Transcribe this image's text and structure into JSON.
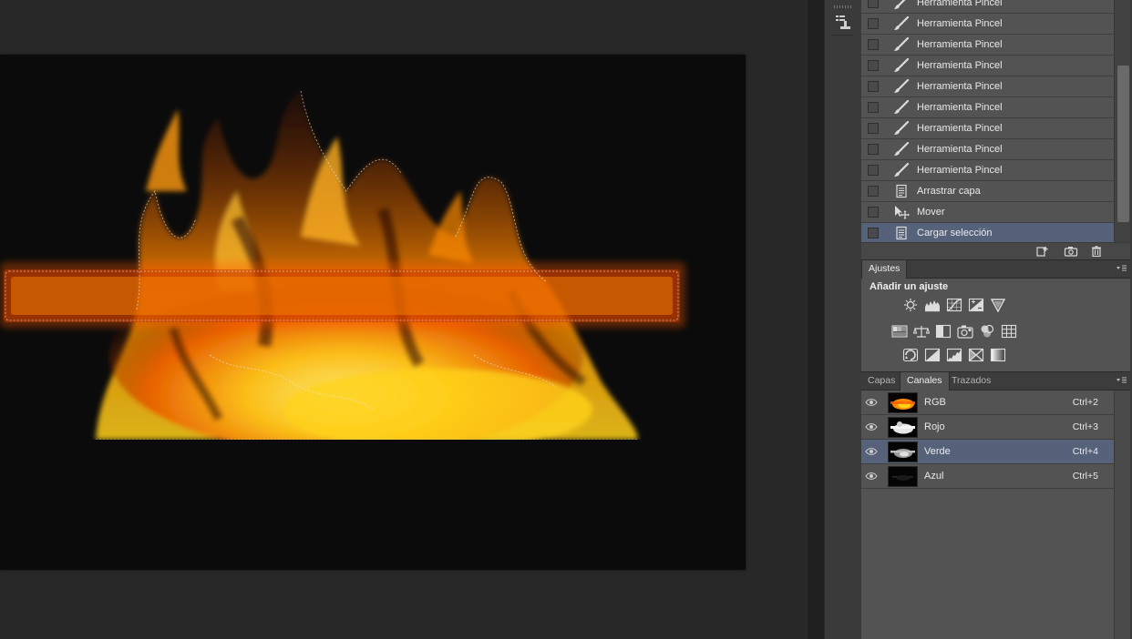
{
  "history": {
    "items": [
      {
        "label": "Herramienta Pincel",
        "icon": "brush-icon",
        "selected": false
      },
      {
        "label": "Herramienta Pincel",
        "icon": "brush-icon",
        "selected": false
      },
      {
        "label": "Herramienta Pincel",
        "icon": "brush-icon",
        "selected": false
      },
      {
        "label": "Herramienta Pincel",
        "icon": "brush-icon",
        "selected": false
      },
      {
        "label": "Herramienta Pincel",
        "icon": "brush-icon",
        "selected": false
      },
      {
        "label": "Herramienta Pincel",
        "icon": "brush-icon",
        "selected": false
      },
      {
        "label": "Herramienta Pincel",
        "icon": "brush-icon",
        "selected": false
      },
      {
        "label": "Herramienta Pincel",
        "icon": "brush-icon",
        "selected": false
      },
      {
        "label": "Herramienta Pincel",
        "icon": "brush-icon",
        "selected": false
      },
      {
        "label": "Arrastrar capa",
        "icon": "document-icon",
        "selected": false
      },
      {
        "label": "Mover",
        "icon": "move-tool-icon",
        "selected": false
      },
      {
        "label": "Cargar selección",
        "icon": "document-icon",
        "selected": true
      }
    ],
    "footer_icons": [
      "new-document-from-state-icon",
      "camera-snapshot-icon",
      "trash-icon"
    ]
  },
  "adjustments": {
    "tab": "Ajustes",
    "title": "Añadir un ajuste",
    "rows": [
      [
        "brightness-icon",
        "levels-icon",
        "curves-icon",
        "exposure-icon",
        "vibrance-icon"
      ],
      [
        "hue-saturation-icon",
        "color-balance-icon",
        "black-white-icon",
        "photo-filter-icon",
        "channel-mixer-icon",
        "color-lookup-icon"
      ],
      [
        "invert-icon",
        "posterize-icon",
        "threshold-icon",
        "selective-color-icon",
        "gradient-map-icon"
      ]
    ]
  },
  "channels_panel": {
    "tabs": [
      {
        "label": "Capas",
        "active": false
      },
      {
        "label": "Canales",
        "active": true
      },
      {
        "label": "Trazados",
        "active": false
      }
    ],
    "channels": [
      {
        "name": "RGB",
        "shortcut": "Ctrl+2",
        "selected": false,
        "thumb": "color"
      },
      {
        "name": "Rojo",
        "shortcut": "Ctrl+3",
        "selected": false,
        "thumb": "bright"
      },
      {
        "name": "Verde",
        "shortcut": "Ctrl+4",
        "selected": true,
        "thumb": "mid"
      },
      {
        "name": "Azul",
        "shortcut": "Ctrl+5",
        "selected": false,
        "thumb": "dark"
      }
    ]
  },
  "colors": {
    "panel_bg": "#535353",
    "selected_row": "#56627a",
    "canvas_bg": "#282828",
    "document_bg": "#0b0b0b",
    "fire_orange": "#ff8a00",
    "fire_yellow": "#ffd21a"
  }
}
